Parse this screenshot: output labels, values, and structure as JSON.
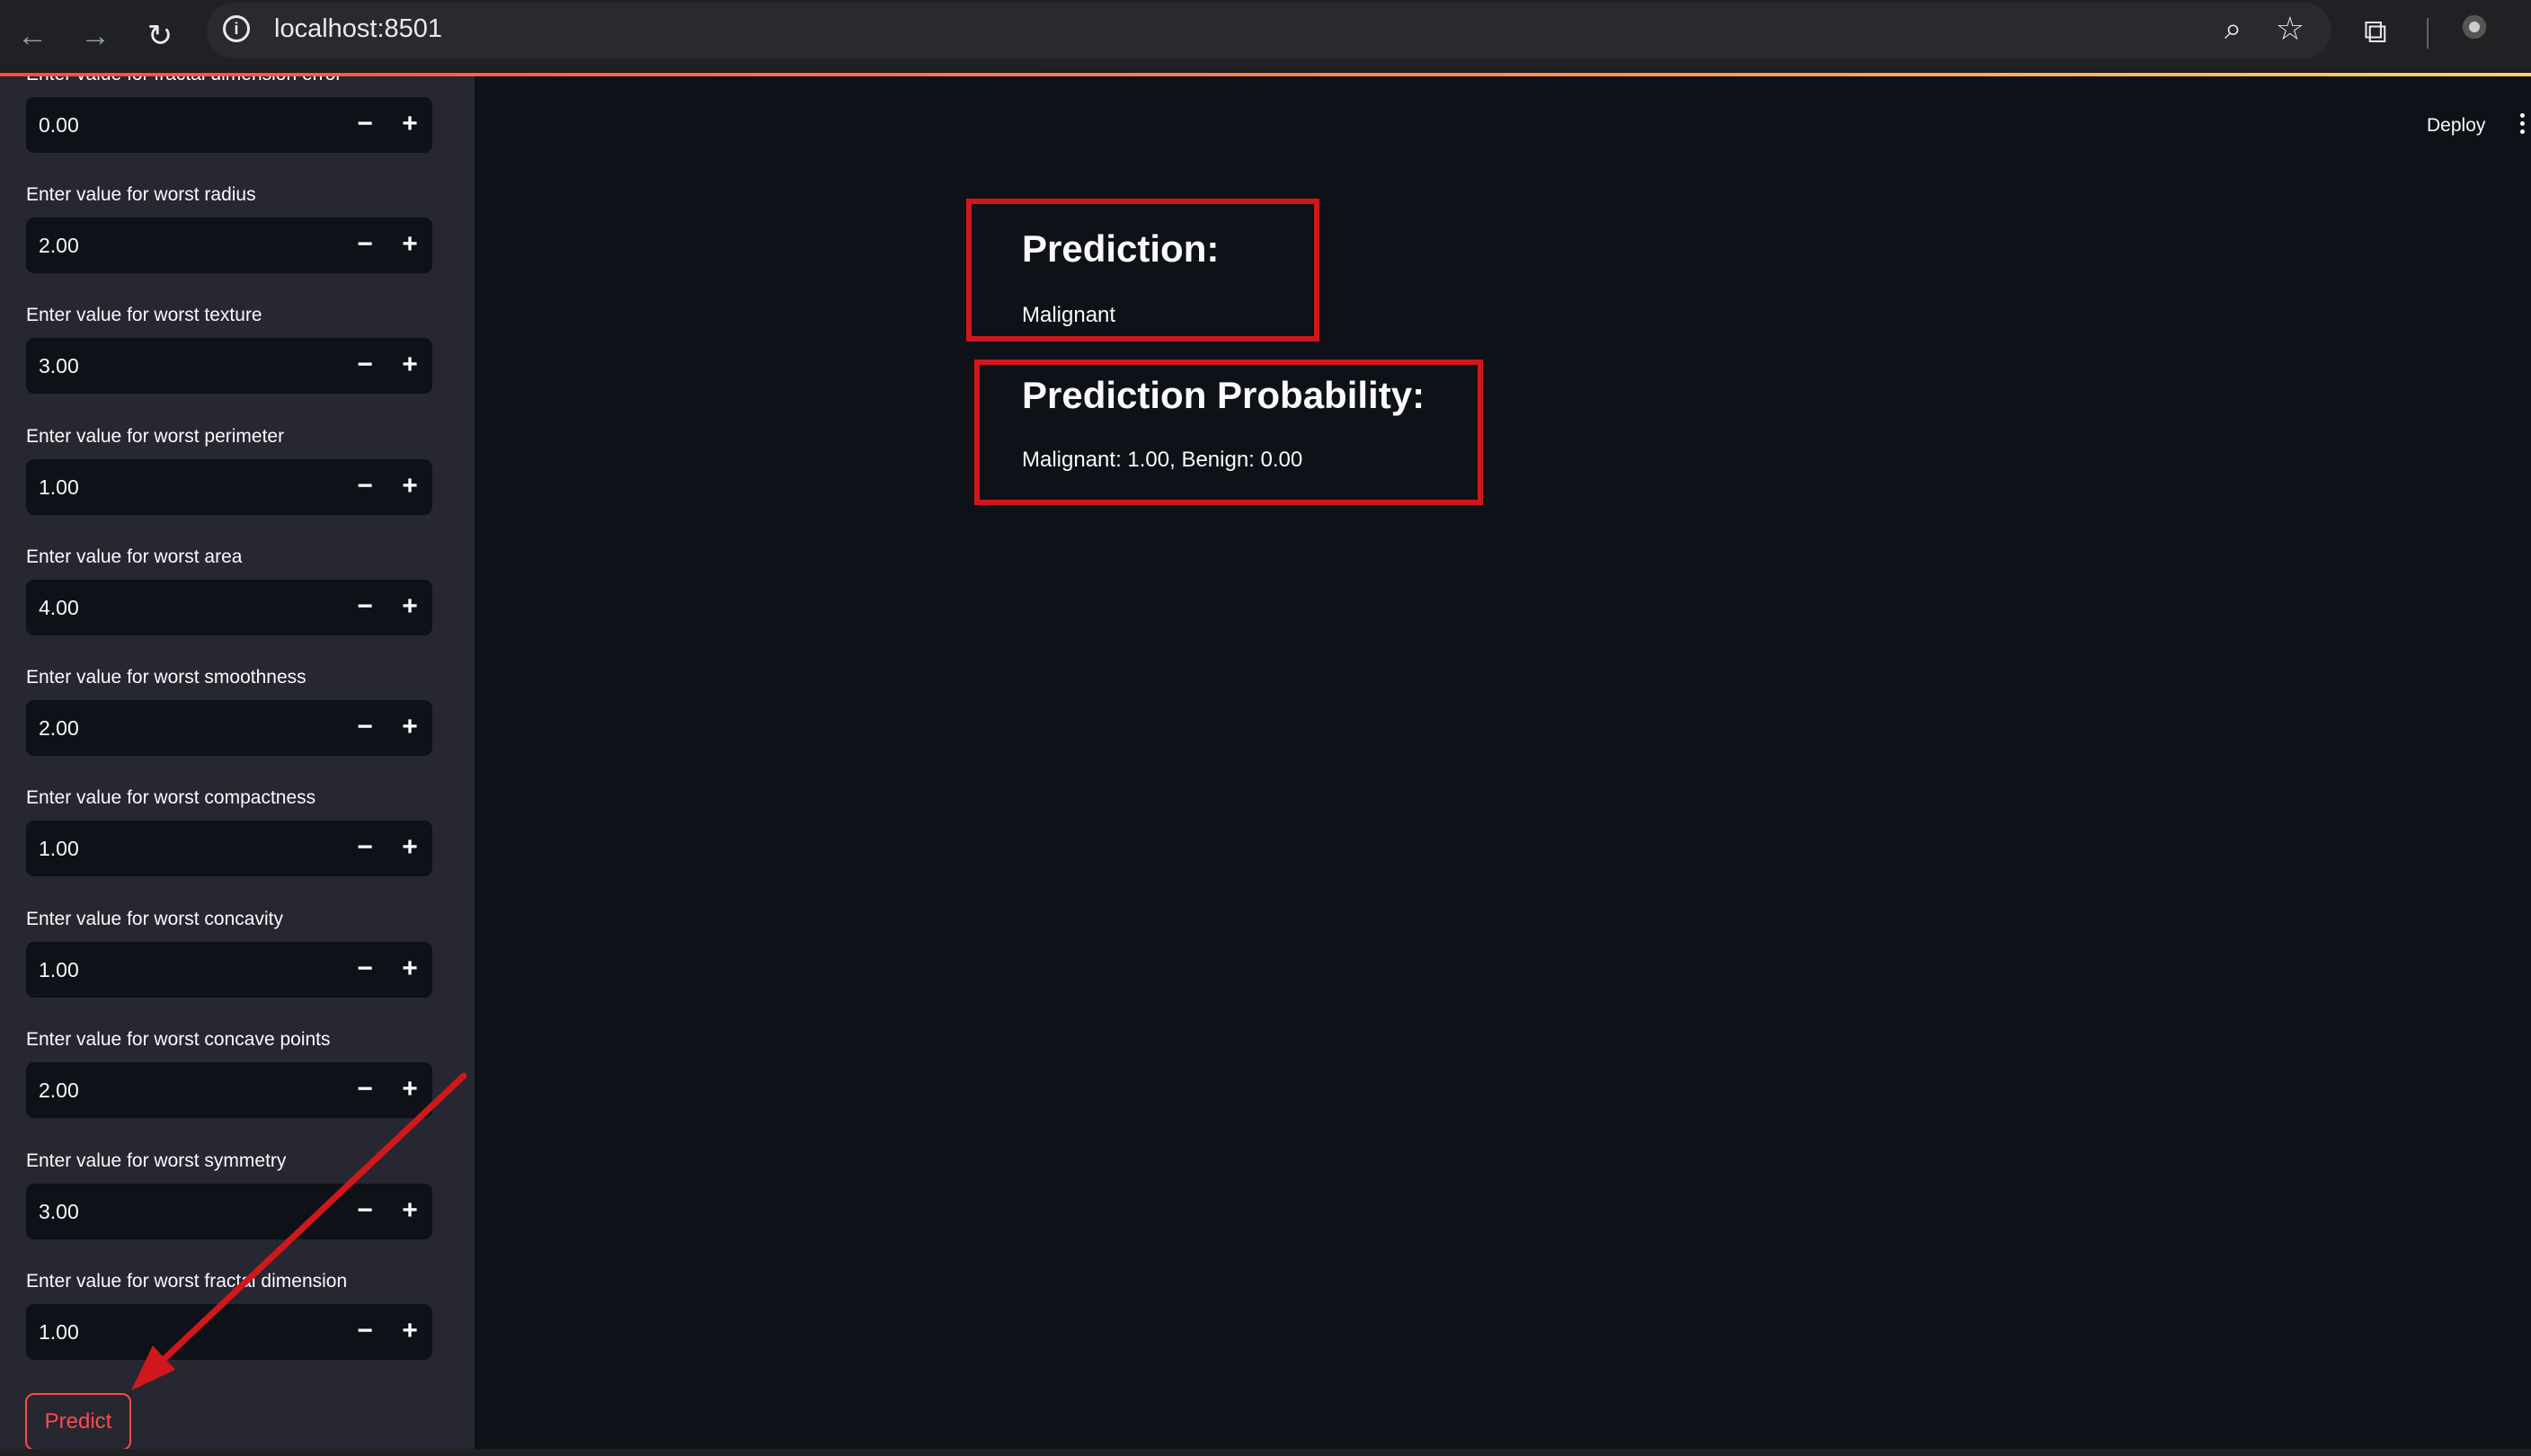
{
  "browser": {
    "url": "localhost:8501"
  },
  "header": {
    "deploy_label": "Deploy"
  },
  "sidebar": {
    "fields": [
      {
        "label": "Enter value for fractal dimension error",
        "value": "0.00"
      },
      {
        "label": "Enter value for worst radius",
        "value": "2.00"
      },
      {
        "label": "Enter value for worst texture",
        "value": "3.00"
      },
      {
        "label": "Enter value for worst perimeter",
        "value": "1.00"
      },
      {
        "label": "Enter value for worst area",
        "value": "4.00"
      },
      {
        "label": "Enter value for worst smoothness",
        "value": "2.00"
      },
      {
        "label": "Enter value for worst compactness",
        "value": "1.00"
      },
      {
        "label": "Enter value for worst concavity",
        "value": "1.00"
      },
      {
        "label": "Enter value for worst concave points",
        "value": "2.00"
      },
      {
        "label": "Enter value for worst symmetry",
        "value": "3.00"
      },
      {
        "label": "Enter value for worst fractal dimension",
        "value": "1.00"
      }
    ],
    "stepper_minus": "−",
    "stepper_plus": "+",
    "predict_label": "Predict"
  },
  "main": {
    "prediction_heading": "Prediction:",
    "prediction_value": "Malignant",
    "probability_heading": "Prediction Probability:",
    "probability_value": "Malignant: 1.00, Benign: 0.00"
  },
  "colors": {
    "accent": "#ff4b4b",
    "annotation": "#d0181c",
    "background": "#0e1117",
    "sidebar": "#262730"
  }
}
